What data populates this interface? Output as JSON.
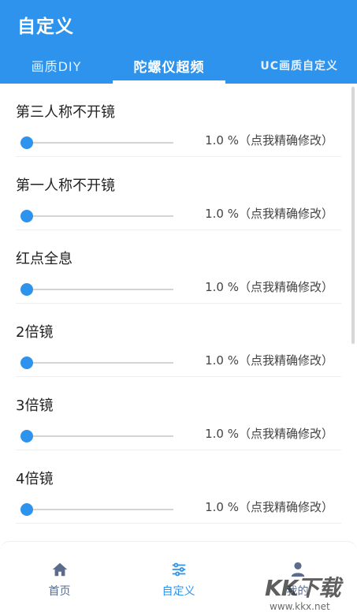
{
  "app": {
    "title": "自定义"
  },
  "tabs": [
    {
      "label": "画质DIY",
      "active": false
    },
    {
      "label": "陀螺仪超频",
      "active": true
    },
    {
      "label": "UC画质自定义",
      "active": false
    }
  ],
  "items": [
    {
      "label": "第三人称不开镜",
      "value": "1.0",
      "unit": "%",
      "hint": "（点我精确修改）",
      "level": 0.0
    },
    {
      "label": "第一人称不开镜",
      "value": "1.0",
      "unit": "%",
      "hint": "（点我精确修改）",
      "level": 0.0
    },
    {
      "label": "红点全息",
      "value": "1.0",
      "unit": "%",
      "hint": "（点我精确修改）",
      "level": 0.0
    },
    {
      "label": "2倍镜",
      "value": "1.0",
      "unit": "%",
      "hint": "（点我精确修改）",
      "level": 0.0
    },
    {
      "label": "3倍镜",
      "value": "1.0",
      "unit": "%",
      "hint": "（点我精确修改）",
      "level": 0.0
    },
    {
      "label": "4倍镜",
      "value": "1.0",
      "unit": "%",
      "hint": "（点我精确修改）",
      "level": 0.0
    }
  ],
  "nav": [
    {
      "label": "首页",
      "icon": "home-icon",
      "active": false
    },
    {
      "label": "自定义",
      "icon": "sliders-icon",
      "active": true
    },
    {
      "label": "我的",
      "icon": "user-icon",
      "active": false
    }
  ],
  "watermark": {
    "main": "KK下载",
    "url": "www.kkx.net"
  },
  "colors": {
    "primary": "#2e93ec",
    "nav_inactive": "#5a6b8c"
  }
}
